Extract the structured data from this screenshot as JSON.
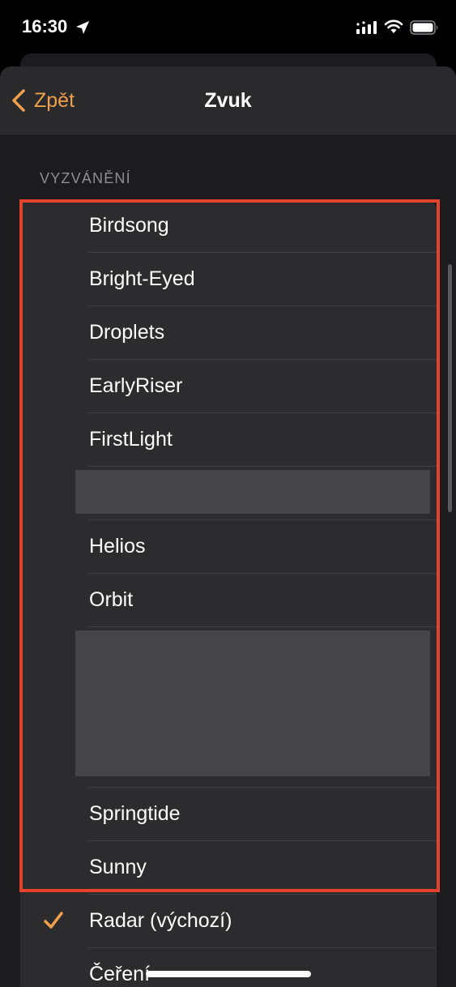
{
  "status_bar": {
    "time": "16:30",
    "icons": [
      "location-arrow-icon",
      "cellular-signal-icon",
      "wifi-icon",
      "battery-icon"
    ]
  },
  "nav": {
    "back_label": "Zpět",
    "title": "Zvuk"
  },
  "section": {
    "header": "VYZVÁNĚNÍ"
  },
  "ringtones": [
    {
      "label": "Birdsong"
    },
    {
      "label": "Bright-Eyed"
    },
    {
      "label": "Droplets"
    },
    {
      "label": "EarlyRiser"
    },
    {
      "label": "FirstLight"
    },
    {
      "label": "Helios"
    },
    {
      "label": "Orbit"
    },
    {
      "label": "Springtide"
    },
    {
      "label": "Sunny"
    }
  ],
  "default_option": {
    "label": "Radar (výchozí)",
    "selected": true
  },
  "next_option": {
    "label": "Čeření"
  },
  "colors": {
    "accent": "#f0a04b",
    "highlight_border": "#e2432a",
    "background": "#1c1c1e",
    "row_background": "#2c2c2e",
    "redaction": "#454547"
  }
}
